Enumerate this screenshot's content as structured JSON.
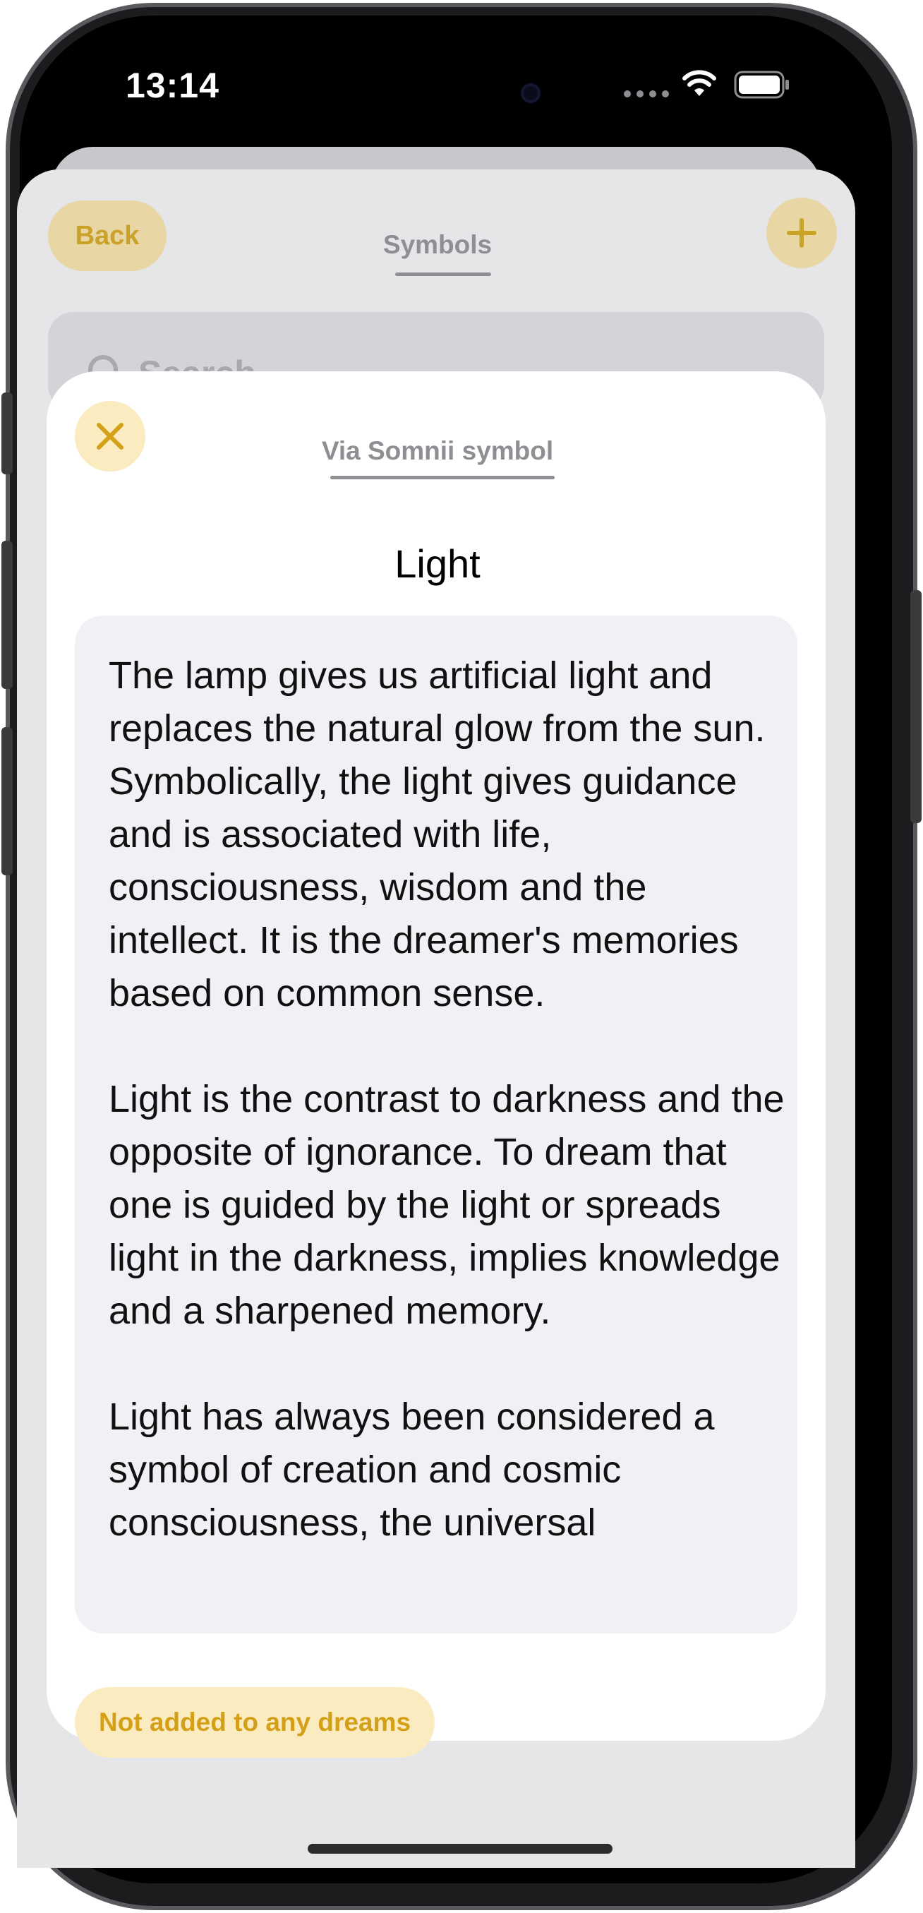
{
  "status_bar": {
    "time": "13:14"
  },
  "background_screen": {
    "back_label": "Back",
    "tab_title": "Symbols",
    "search_placeholder": "Search"
  },
  "modal": {
    "tab_title": "Via Somnii symbol",
    "symbol_name": "Light",
    "description_paragraphs": [
      "The lamp gives us artificial light and replaces the natural glow from the sun. Symbolically, the light gives guidance and is associated with life, consciousness, wisdom and the intellect. It is the dreamer's memories based on common sense.",
      "Light is the contrast to darkness and the opposite of ignorance. To dream that one is guided by the light or spreads light in the darkness, implies knowledge and a sharpened memory.",
      "Light has always been considered a symbol of creation and cosmic consciousness, the universal"
    ],
    "dreams_badge": "Not added to any dreams"
  },
  "icons": {
    "close": "close-icon",
    "add": "plus-icon",
    "search": "search-icon",
    "wifi": "wifi-icon",
    "battery": "battery-icon"
  },
  "colors": {
    "accent": "#d4a017",
    "accent_light": "#fbebc0",
    "muted_tab": "#8e8e93",
    "card_bg": "#f1f1f5"
  }
}
